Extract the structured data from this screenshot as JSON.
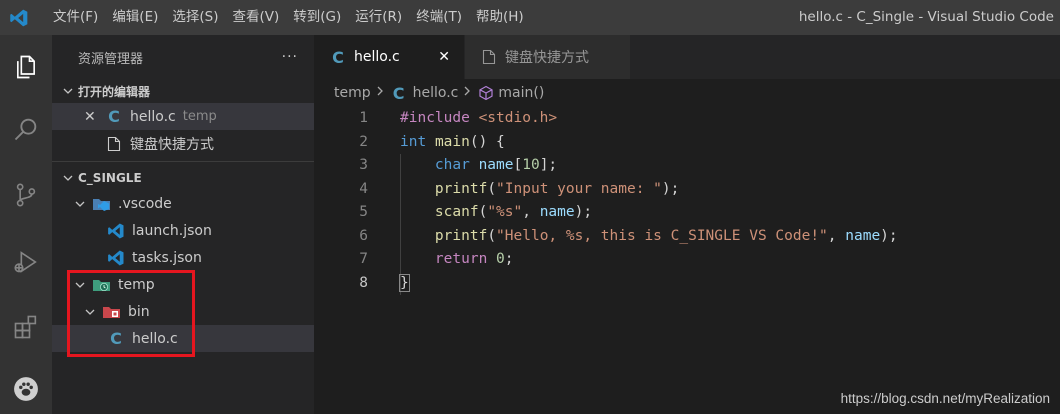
{
  "titlebar": {
    "menu": [
      "文件(F)",
      "编辑(E)",
      "选择(S)",
      "查看(V)",
      "转到(G)",
      "运行(R)",
      "终端(T)",
      "帮助(H)"
    ],
    "window_title": "hello.c - C_Single - Visual Studio Code",
    "logo_icon": "vscode-logo-icon"
  },
  "activitybar": {
    "icons": [
      "explorer-icon",
      "search-icon",
      "source-control-icon",
      "run-debug-icon",
      "extensions-icon",
      "paw-icon"
    ]
  },
  "sidebar": {
    "title": "资源管理器",
    "more": "···",
    "open_editors": {
      "header": "打开的编辑器",
      "items": [
        {
          "name": "hello.c",
          "desc": "temp",
          "icon": "c-file-icon"
        },
        {
          "name": "键盘快捷方式",
          "icon": "file-icon"
        }
      ]
    },
    "workspace": {
      "header": "C_SINGLE",
      "tree": [
        {
          "name": ".vscode",
          "icon": "vscode-folder-icon"
        },
        {
          "name": "launch.json",
          "icon": "vscode-json-icon"
        },
        {
          "name": "tasks.json",
          "icon": "vscode-json-icon"
        },
        {
          "name": "temp",
          "icon": "temp-folder-icon"
        },
        {
          "name": "bin",
          "icon": "bin-folder-icon"
        },
        {
          "name": "hello.c",
          "icon": "c-file-icon"
        }
      ]
    }
  },
  "tabs": [
    {
      "label": "hello.c",
      "active": true
    },
    {
      "label": "键盘快捷方式",
      "active": false
    }
  ],
  "breadcrumb": {
    "folder": "temp",
    "file": "hello.c",
    "symbol": "main()"
  },
  "editor": {
    "line_numbers": [
      "1",
      "2",
      "3",
      "4",
      "5",
      "6",
      "7",
      "8"
    ],
    "current_line": "8",
    "lines": {
      "l1": {
        "pp": "#include",
        "inc": "<stdio.h>"
      },
      "l2": {
        "type": "int",
        "fn": "main",
        "rest": "() {"
      },
      "l3": {
        "type": "char",
        "var": "name",
        "open": "[",
        "num": "10",
        "close": "];"
      },
      "l4": {
        "fn": "printf",
        "open": "(",
        "str": "\"Input your name: \"",
        "close": ");"
      },
      "l5": {
        "fn": "scanf",
        "open": "(",
        "str": "\"%s\"",
        "comma": ", ",
        "var": "name",
        "close": ");"
      },
      "l6": {
        "fn": "printf",
        "open": "(",
        "str": "\"Hello, %s, this is C_SINGLE VS Code!\"",
        "comma": ", ",
        "var": "name",
        "close": ");"
      },
      "l7": {
        "kw": "return",
        "num": "0",
        "close": ";"
      },
      "l8": {
        "brace": "}"
      }
    }
  },
  "watermark": "https://blog.csdn.net/myRealization"
}
